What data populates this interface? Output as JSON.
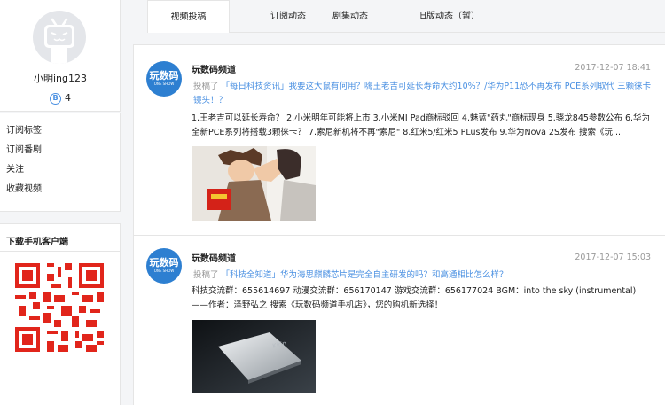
{
  "profile": {
    "username": "小明ing123",
    "coins": "4",
    "coin_symbol": "B"
  },
  "menu": {
    "items": [
      "订阅标签",
      "订阅番剧",
      "关注",
      "收藏视频"
    ]
  },
  "download": {
    "title": "下载手机客户端"
  },
  "tabs": [
    {
      "label": "视频投稿",
      "active": true
    },
    {
      "label": "订阅动态",
      "active": false
    },
    {
      "label": "剧集动态",
      "active": false
    },
    {
      "label": "旧版动态（暂）",
      "active": false
    }
  ],
  "posts": [
    {
      "channel": "玩数码频道",
      "logo_text": "玩数码",
      "logo_sub": "ONE SHOW",
      "date": "2017-12-07 18:41",
      "tag": "投稿了",
      "title": "「每日科技资讯」我要这大鼠有何用？嗨王老吉可延长寿命大约10%？/华为P11恐不再发布 PCE系列取代 三颗徕卡镜头！？",
      "description": "1.王老吉可以延长寿命？ 2.小米明年可能将上市 3.小米MI Pad商标驳回 4.魅蓝\"药丸\"商标现身 5.骁龙845参数公布 6.华为全新PCE系列将搭载3颗徕卡？ 7.索尼新机将不再\"索尼\" 8.红米5/红米5 PLus发布 9.华为Nova 2S发布 搜索《玩..."
    },
    {
      "channel": "玩数码频道",
      "logo_text": "玩数码",
      "logo_sub": "ONE SHOW",
      "date": "2017-12-07 15:03",
      "tag": "投稿了",
      "title": "「科技全知道」华为海思麒麟芯片是完全自主研发的吗？和高通相比怎么样？",
      "description": "科技交流群：655614697 动漫交流群：656170147 游戏交流群：656177024 BGM：into the sky (instrumental)——作者：泽野弘之 搜索《玩数码频道手机店》，您的购机新选择！"
    }
  ],
  "colors": {
    "link": "#4a90e2",
    "muted": "#999999",
    "logo_bg": "#2d7fd1",
    "page_bg": "#f4f5f7"
  }
}
